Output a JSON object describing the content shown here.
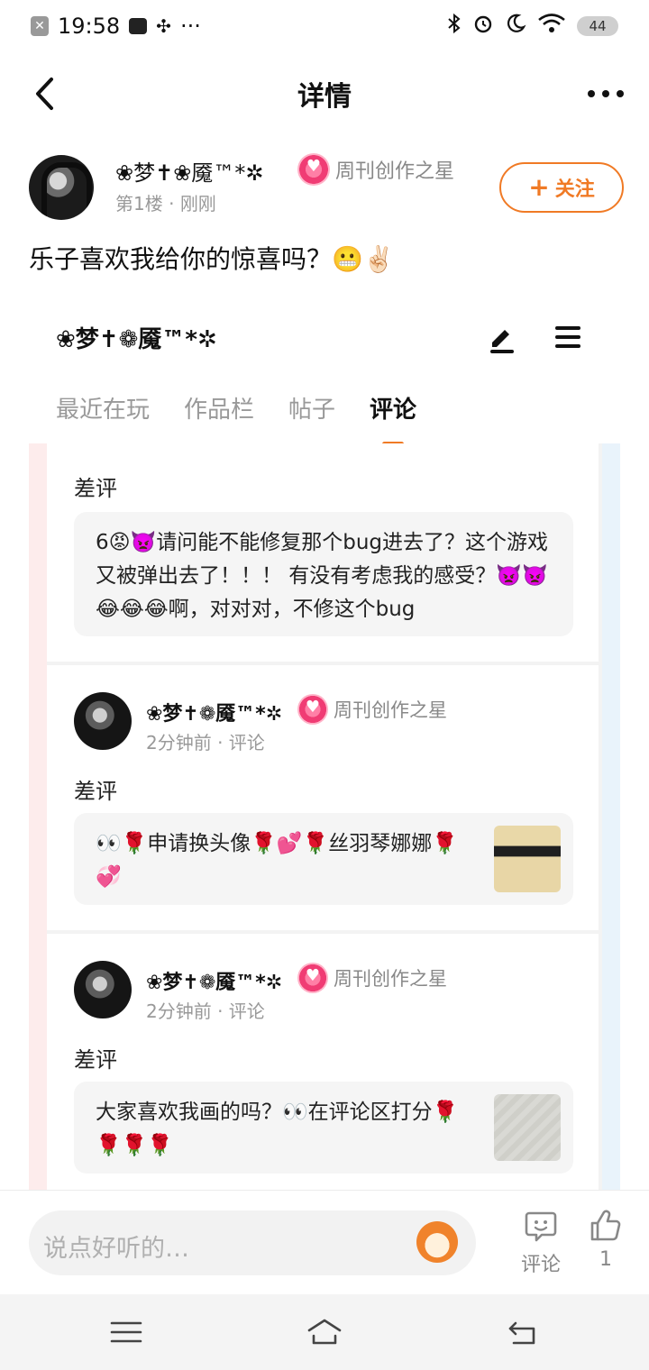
{
  "status_bar": {
    "time": "19:58",
    "battery": "44",
    "notification_icons": [
      "close-box-icon",
      "message-icon",
      "fan-icon",
      "more-dots"
    ],
    "system_icons": [
      "bluetooth-icon",
      "alarm-icon",
      "moon-icon",
      "wifi-icon"
    ]
  },
  "header": {
    "title": "详情",
    "more_label": "•••"
  },
  "post": {
    "author": "❀梦✝❀魇™*✲",
    "badge": "周刊创作之星",
    "floor": "第1楼",
    "time": "刚刚",
    "follow_label": "关注",
    "text": "乐子喜欢我给你的惊喜吗？😬✌🏻"
  },
  "embed": {
    "username": "❀梦✝❁魇™*✲",
    "tabs": [
      "最近在玩",
      "作品栏",
      "帖子",
      "评论"
    ],
    "active_tab": 3,
    "cards": [
      {
        "rating": "差评",
        "quote": "6😡👿请问能不能修复那个bug进去了？这个游戏又被弹出去了！！！ 有没有考虑我的感受？👿👿😂😂😂啊，对对对，不修这个bug"
      },
      {
        "name": "❀梦✝❁魇™*✲",
        "badge": "周刊创作之星",
        "meta": "2分钟前 · 评论",
        "rating": "差评",
        "quote": "👀🌹申请换头像🌹💕🌹丝羽琴娜娜🌹💞"
      },
      {
        "name": "❀梦✝❁魇™*✲",
        "badge": "周刊创作之星",
        "meta": "2分钟前 · 评论",
        "rating": "差评",
        "quote": "大家喜欢我画的吗？👀在评论区打分🌹🌹🌹🌹"
      }
    ]
  },
  "comment_bar": {
    "placeholder": "说点好听的…",
    "comment_label": "评论",
    "like_count": "1"
  },
  "colors": {
    "accent": "#f07a25",
    "badge_pink": "#f03c74",
    "muted_text": "#999999"
  }
}
